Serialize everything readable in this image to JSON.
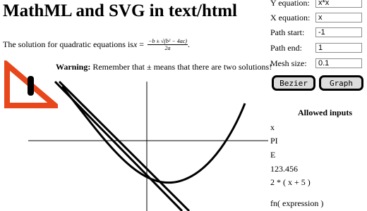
{
  "title": "MathML and SVG in text/html",
  "intro": {
    "text": "The solution for quadratic equations is ",
    "var": "x",
    "numerator": "−b ± √(b² − 4ac)",
    "denominator": "2a"
  },
  "warning": {
    "label": "Warning:",
    "text": " Remember that ± means that there are two solutions!"
  },
  "controls": {
    "y_equation": {
      "label": "Y equation:",
      "value": "x*x"
    },
    "x_equation": {
      "label": "X equation:",
      "value": "x"
    },
    "path_start": {
      "label": "Path start:",
      "value": "-1"
    },
    "path_end": {
      "label": "Path end:",
      "value": "1"
    },
    "mesh_size": {
      "label": "Mesh size:",
      "value": "0.1"
    },
    "bezier_label": "Bezier",
    "graph_label": "Graph"
  },
  "allowed": {
    "heading": "Allowed inputs",
    "items": [
      "x",
      "PI",
      "E",
      "123.456",
      "2 * ( x + 5 )",
      "fn( expression )"
    ]
  },
  "colors": {
    "warning_sign": "#e8471c",
    "accent": "#000000"
  }
}
